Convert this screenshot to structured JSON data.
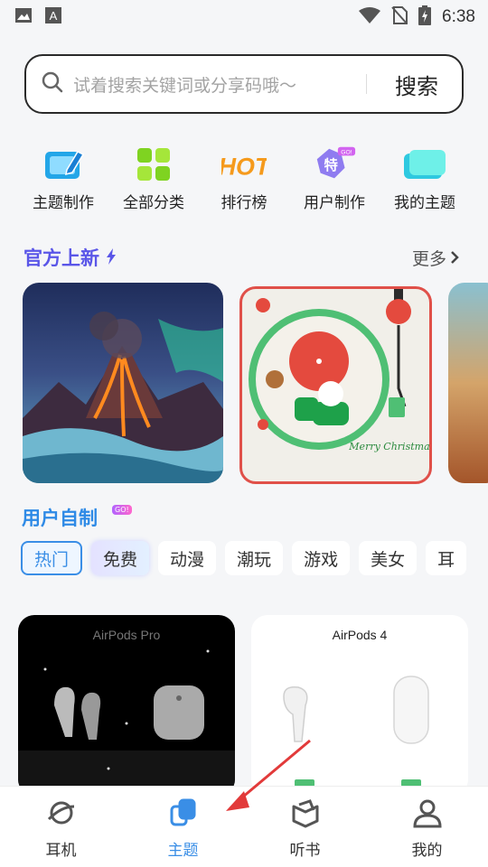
{
  "status_bar": {
    "time": "6:38"
  },
  "search": {
    "placeholder": "试着搜索关键词或分享码哦～",
    "button_label": "搜索"
  },
  "shortcuts": [
    {
      "label": "主题制作",
      "icon": "theme-edit-icon"
    },
    {
      "label": "全部分类",
      "icon": "category-grid-icon"
    },
    {
      "label": "排行榜",
      "icon": "hot-icon",
      "icon_text": "HOT"
    },
    {
      "label": "用户制作",
      "icon": "user-made-icon",
      "icon_text": "特",
      "badge": "GO!"
    },
    {
      "label": "我的主题",
      "icon": "my-theme-icon"
    }
  ],
  "official": {
    "title": "官方上新",
    "more_label": "更多"
  },
  "official_cards": [
    {
      "name": "volcano-theme"
    },
    {
      "name": "merry-christmas-theme",
      "text": "Merry Christmas!"
    }
  ],
  "user_section": {
    "title": "用户自制",
    "badge": "GO!"
  },
  "chips": [
    "热门",
    "免费",
    "动漫",
    "潮玩",
    "游戏",
    "美女",
    "耳"
  ],
  "products": [
    {
      "title": "AirPods Pro"
    },
    {
      "title": "AirPods 4"
    }
  ],
  "bottom_nav": [
    {
      "label": "耳机"
    },
    {
      "label": "主题",
      "active": true
    },
    {
      "label": "听书"
    },
    {
      "label": "我的"
    }
  ],
  "colors": {
    "accent": "#3a8ee6",
    "official_title": "#5a56e8",
    "xmas_red": "#e05049",
    "annotation_arrow": "#e23a3a"
  }
}
